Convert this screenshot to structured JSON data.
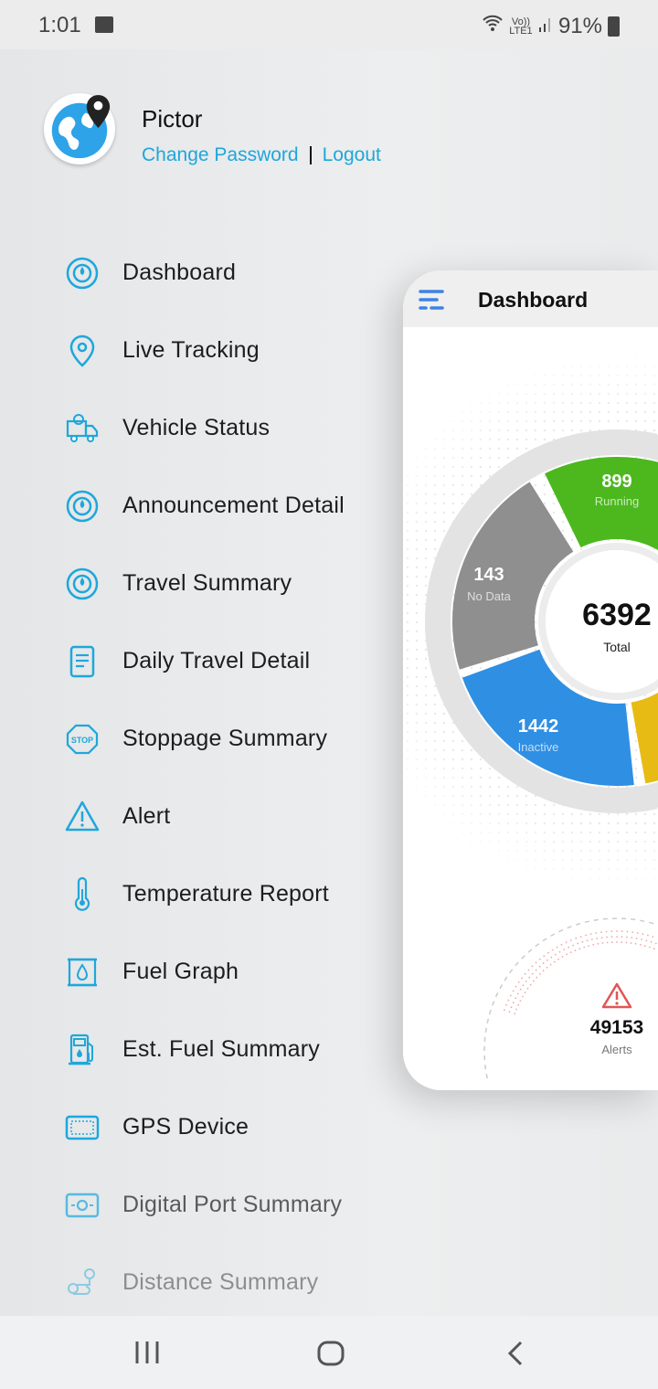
{
  "status_bar": {
    "time": "1:01",
    "network": "Vo)) LTE1",
    "battery": "91%"
  },
  "profile": {
    "name": "Pictor",
    "change_password": "Change Password",
    "logout": "Logout"
  },
  "menu": [
    {
      "label": "Dashboard",
      "icon": "dashboard-icon"
    },
    {
      "label": "Live Tracking",
      "icon": "location-pin-icon"
    },
    {
      "label": "Vehicle Status",
      "icon": "truck-icon"
    },
    {
      "label": "Announcement Detail",
      "icon": "dashboard-icon"
    },
    {
      "label": "Travel Summary",
      "icon": "dashboard-icon"
    },
    {
      "label": "Daily Travel Detail",
      "icon": "document-icon"
    },
    {
      "label": "Stoppage Summary",
      "icon": "stop-sign-icon"
    },
    {
      "label": "Alert",
      "icon": "warning-icon"
    },
    {
      "label": "Temperature Report",
      "icon": "thermometer-icon"
    },
    {
      "label": "Fuel Graph",
      "icon": "fuel-drop-icon"
    },
    {
      "label": "Est. Fuel Summary",
      "icon": "fuel-pump-icon"
    },
    {
      "label": "GPS Device",
      "icon": "gps-device-icon"
    },
    {
      "label": "Digital Port Summary",
      "icon": "port-icon"
    },
    {
      "label": "Distance Summary",
      "icon": "route-icon"
    }
  ],
  "dashboard": {
    "title": "Dashboard",
    "total": {
      "value": "6392",
      "label": "Total"
    },
    "segments": [
      {
        "value": "899",
        "label": "Running",
        "color": "#4cb81e"
      },
      {
        "value": "143",
        "label": "No Data",
        "color": "#8f8f8f"
      },
      {
        "value": "1442",
        "label": "Inactive",
        "color": "#2f8fe3"
      },
      {
        "value": "",
        "label": "",
        "color": "#e8bb14"
      }
    ],
    "alerts": {
      "value": "49153",
      "label": "Alerts"
    }
  },
  "accent": "#1ea7db"
}
